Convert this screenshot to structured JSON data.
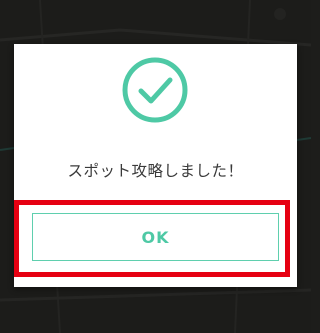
{
  "dialog": {
    "icon": "check-circle-icon",
    "message": "スポット攻略しました！",
    "ok_label": "OK"
  },
  "colors": {
    "accent": "#4ec9a5",
    "highlight": "#e60012",
    "background": "#1d1d1b"
  }
}
